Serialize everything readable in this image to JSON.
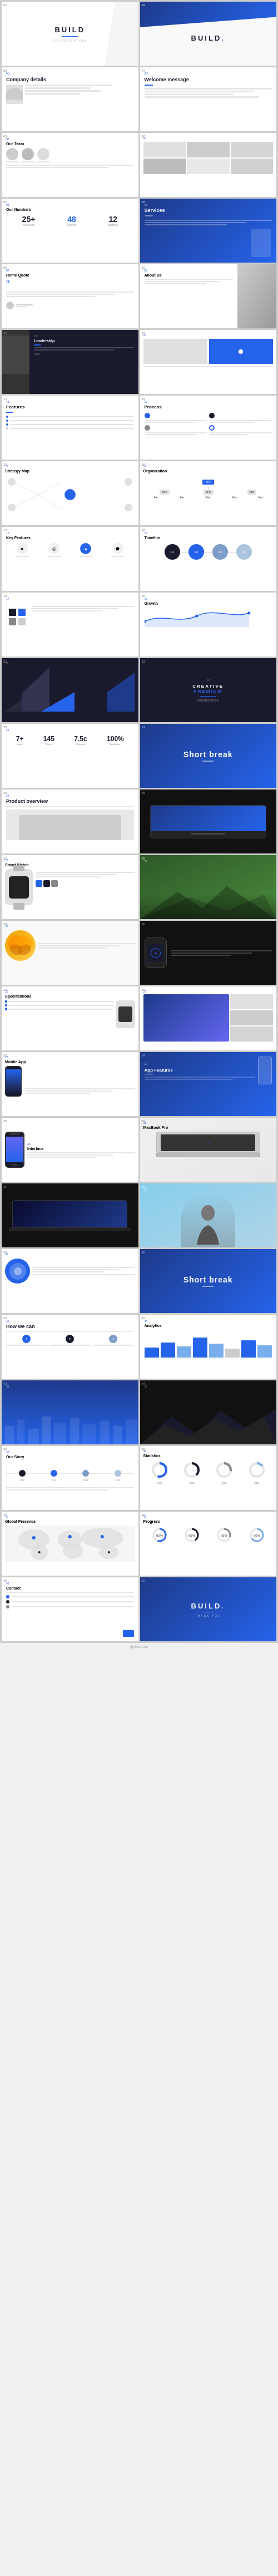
{
  "brand": {
    "name": "BUILD",
    "dot": "."
  },
  "slides": [
    {
      "num": "01",
      "type": "cover",
      "label": "Cover slide with logo"
    },
    {
      "num": "02",
      "type": "cover2",
      "label": "Cover variation"
    },
    {
      "num": "03",
      "type": "company_details",
      "title": "Company details"
    },
    {
      "num": "04",
      "type": "welcome",
      "title": "Welcome message"
    },
    {
      "num": "05",
      "type": "team_text",
      "label": "Team with text"
    },
    {
      "num": "06",
      "type": "portfolio",
      "label": "Portfolio grid"
    },
    {
      "num": "07",
      "type": "stats_row",
      "label": "Stats row"
    },
    {
      "num": "08",
      "type": "blue_feature",
      "label": "Blue feature"
    },
    {
      "num": "09",
      "type": "quote",
      "label": "Home Quote",
      "title": "Home Quote"
    },
    {
      "num": "10",
      "type": "photo_right",
      "label": "Photo right"
    },
    {
      "num": "11",
      "type": "person_dark",
      "label": "Person dark bg"
    },
    {
      "num": "12",
      "type": "blue_accent",
      "label": "Blue accent slide"
    },
    {
      "num": "13",
      "type": "title_list",
      "label": "Title with list"
    },
    {
      "num": "14",
      "type": "title_list2",
      "label": "Title with list 2"
    },
    {
      "num": "15",
      "type": "mindmap",
      "label": "Mind map"
    },
    {
      "num": "16",
      "type": "org_chart",
      "label": "Org chart"
    },
    {
      "num": "17",
      "type": "icons_row",
      "label": "Icons row"
    },
    {
      "num": "18",
      "type": "circles_infographic",
      "label": "Circles infographic"
    },
    {
      "num": "19",
      "type": "puzzle",
      "label": "Puzzle infographic"
    },
    {
      "num": "20",
      "type": "wave_stats",
      "label": "Wave stats"
    },
    {
      "num": "21",
      "type": "dark_shapes",
      "label": "Dark angular shapes"
    },
    {
      "num": "22",
      "type": "dark_overlay",
      "label": "Dark text overlay"
    },
    {
      "num": "23",
      "type": "numbers_stats",
      "label": "Large numbers stats"
    },
    {
      "num": "24",
      "type": "short_break_1",
      "label": "Short break blue"
    },
    {
      "num": "25",
      "type": "product_overview",
      "title": "Product overview"
    },
    {
      "num": "26",
      "type": "laptop_dark",
      "label": "Laptop dark"
    },
    {
      "num": "27",
      "type": "watch_product",
      "label": "Smart watch product"
    },
    {
      "num": "28",
      "type": "nature_photo",
      "label": "Nature photo"
    },
    {
      "num": "29",
      "type": "butterfly",
      "label": "Butterfly product"
    },
    {
      "num": "30",
      "type": "watch_dark",
      "label": "Watch dark bg"
    },
    {
      "num": "31",
      "type": "watch_specs",
      "label": "Watch specs"
    },
    {
      "num": "32",
      "type": "phone_photos",
      "label": "Phone photos grid"
    },
    {
      "num": "33",
      "type": "phone_feature",
      "label": "Phone feature"
    },
    {
      "num": "34",
      "type": "phone_blue",
      "label": "Phone blue bg"
    },
    {
      "num": "35",
      "type": "phone_mockup",
      "label": "Phone mockup"
    },
    {
      "num": "36",
      "type": "macbook_specs",
      "label": "MacBook specs"
    },
    {
      "num": "37",
      "type": "macbook_dark",
      "label": "MacBook dark"
    },
    {
      "num": "38",
      "type": "person_photo",
      "label": "Person photo"
    },
    {
      "num": "39",
      "type": "circles_feature",
      "label": "Circles feature"
    },
    {
      "num": "40",
      "type": "short_break_2",
      "label": "Short break 2 blue"
    },
    {
      "num": "41",
      "type": "how_we_can",
      "title": "How we can"
    },
    {
      "num": "42",
      "type": "bar_chart",
      "label": "Bar chart"
    },
    {
      "num": "43",
      "type": "blue_landscape",
      "label": "Blue landscape"
    },
    {
      "num": "44",
      "type": "landscape_dark",
      "label": "Landscape dark"
    },
    {
      "num": "45",
      "type": "timeline_icons",
      "label": "Timeline with icons"
    },
    {
      "num": "46",
      "type": "donut_charts",
      "label": "Donut charts"
    },
    {
      "num": "47",
      "type": "map_world",
      "label": "World map"
    },
    {
      "num": "48",
      "type": "circle_progress",
      "label": "Circle progress"
    },
    {
      "num": "49",
      "type": "final_stats",
      "label": "Final stats"
    },
    {
      "num": "50",
      "type": "closing",
      "label": "Closing slide"
    }
  ],
  "short_break_text": "Short break",
  "product_overview_text": "Product overview",
  "how_we_can_text": "How we can",
  "company_details_text": "Company details",
  "welcome_message_text": "Welcome message",
  "stats": {
    "s1": "7+",
    "s2": "145",
    "s3": "7.5c",
    "s4": "100%"
  },
  "colors": {
    "blue": "#2563eb",
    "dark": "#1a1a2e",
    "lightgray": "#f5f5f5",
    "medgray": "#e0e0e0"
  }
}
